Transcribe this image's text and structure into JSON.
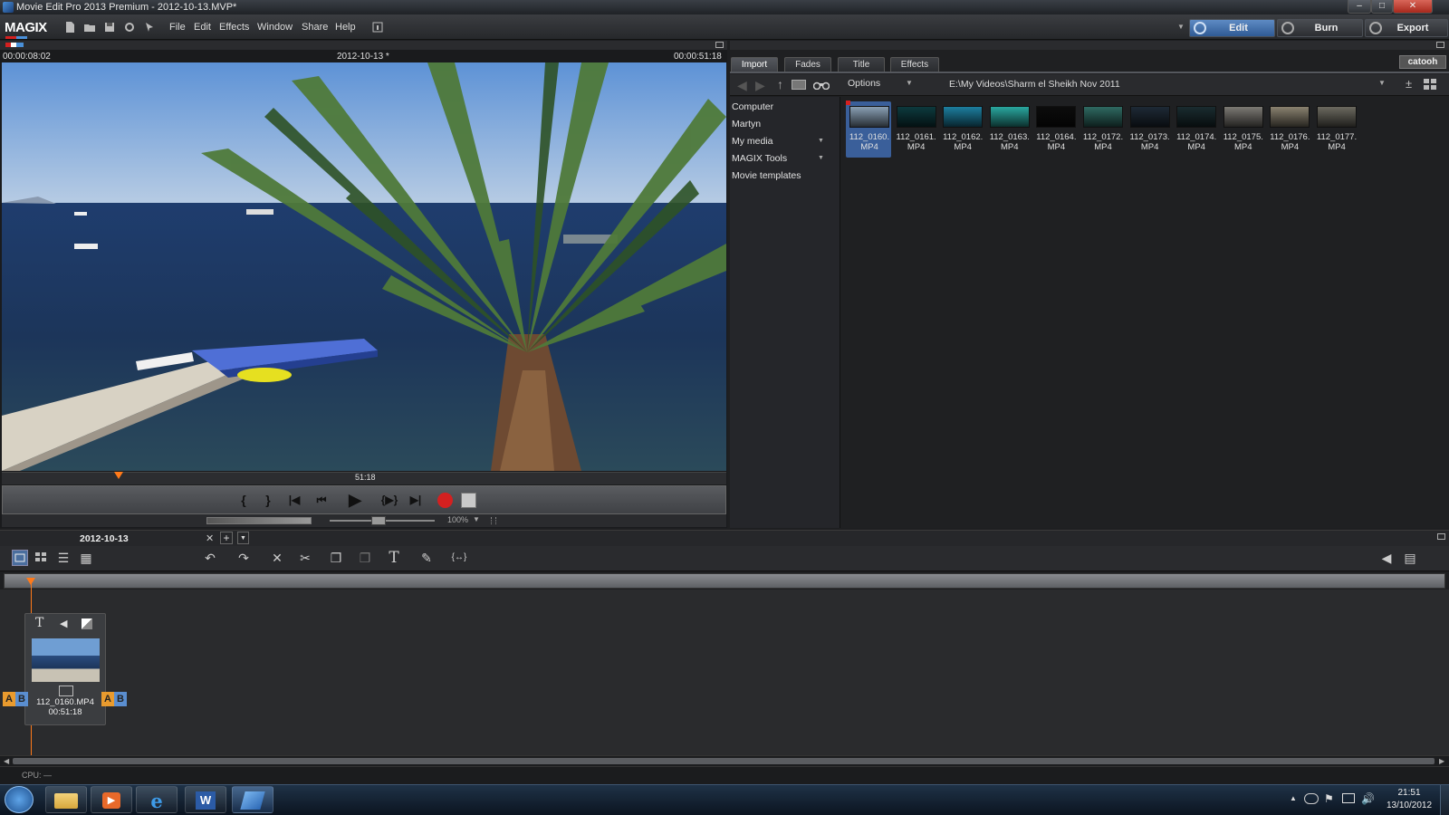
{
  "window": {
    "title": "Movie Edit Pro 2013 Premium - 2012-10-13.MVP*"
  },
  "menu": {
    "logo": "MAGIX",
    "items": [
      "File",
      "Edit",
      "Effects",
      "Window",
      "Share",
      "Help"
    ],
    "modes": {
      "edit": "Edit",
      "burn": "Burn",
      "export": "Export"
    }
  },
  "preview": {
    "timecode_left": "00:00:08:02",
    "project": "2012-10-13 *",
    "timecode_right": "00:00:51:18",
    "scrub_label": "51:18",
    "zoom": "100%",
    "playhead_fraction": 0.16
  },
  "media_pool": {
    "tabs": [
      "Import",
      "Fades",
      "Title",
      "Effects"
    ],
    "active_tab": "Import",
    "brand": "catooh",
    "options_label": "Options",
    "path": "E:\\My Videos\\Sharm el Sheikh Nov 2011",
    "sidebar": [
      "Computer",
      "Martyn",
      "My media",
      "MAGIX Tools",
      "Movie templates"
    ],
    "files": [
      {
        "name": "112_0160.",
        "ext": "MP4",
        "color": "#8aa0b5"
      },
      {
        "name": "112_0161.",
        "ext": "MP4",
        "color": "#0d3a3e"
      },
      {
        "name": "112_0162.",
        "ext": "MP4",
        "color": "#1d7fa0"
      },
      {
        "name": "112_0163.",
        "ext": "MP4",
        "color": "#2aa8a0"
      },
      {
        "name": "112_0164.",
        "ext": "MP4",
        "color": "#0c0c0c"
      },
      {
        "name": "112_0172.",
        "ext": "MP4",
        "color": "#2f6a62"
      },
      {
        "name": "112_0173.",
        "ext": "MP4",
        "color": "#1e2a36"
      },
      {
        "name": "112_0174.",
        "ext": "MP4",
        "color": "#1a2c30"
      },
      {
        "name": "112_0175.",
        "ext": "MP4",
        "color": "#7c7a74"
      },
      {
        "name": "112_0176.",
        "ext": "MP4",
        "color": "#8a8270"
      },
      {
        "name": "112_0177.",
        "ext": "MP4",
        "color": "#6c6a60"
      }
    ]
  },
  "timeline": {
    "tab_label": "2012-10-13",
    "clip": {
      "name": "112_0160.MP4",
      "duration": "00:51:18"
    }
  },
  "status": {
    "cpu": "CPU: —"
  },
  "taskbar": {
    "time": "21:51",
    "date": "13/10/2012"
  },
  "colors": {
    "accent_orange": "#ff7a1a",
    "record_red": "#d42020",
    "selection_blue": "#3a5f9a"
  }
}
